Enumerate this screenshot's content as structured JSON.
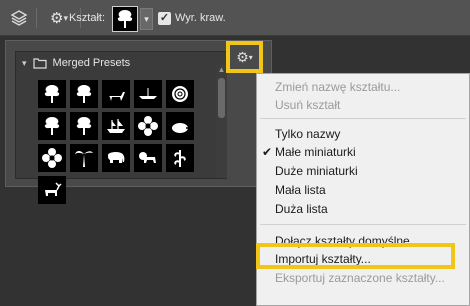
{
  "optbar": {
    "shape_label": "Kształt:",
    "edge_label": "Wyr. kraw.",
    "edge_checked": "✓"
  },
  "panel": {
    "group_title": "Merged Presets",
    "shapes": [
      "tree-icon",
      "tree-icon",
      "deer-icon",
      "boat-icon",
      "rose-icon",
      "tree-icon",
      "tree-icon",
      "ship-icon",
      "flower-icon",
      "hedgehog-icon",
      "flower-icon",
      "palm-icon",
      "elephant-icon",
      "lion-icon",
      "plant-icon",
      "moose-icon"
    ]
  },
  "menu": {
    "rename": "Zmień nazwę kształtu...",
    "delete": "Usuń kształt",
    "names_only": "Tylko nazwy",
    "small_thumbs": "Małe miniaturki",
    "large_thumbs": "Duże miniaturki",
    "small_list": "Mała lista",
    "large_list": "Duża lista",
    "append_defaults": "Dołącz kształty domyślne...",
    "import": "Importuj kształty...",
    "export": "Eksportuj zaznaczone kształty...",
    "check_mark": "✔"
  },
  "colors": {
    "highlight": "#f2c51a"
  }
}
